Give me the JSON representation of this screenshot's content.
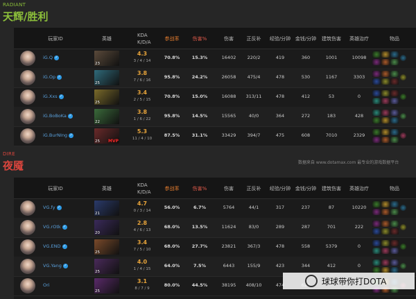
{
  "radiant": {
    "label": "RADIANT",
    "title": "天辉/胜利",
    "accent": "#8cbf3a",
    "columns": {
      "player_id": "玩家ID",
      "hero": "英雄",
      "kda_top": "KDA",
      "kda_bottom": "K/D/A",
      "participation": "参战率",
      "damage_pct": "伤害%",
      "damage": "伤害",
      "lh_dn": "正反补",
      "xpm": "经验/分钟",
      "gpm": "金钱/分钟",
      "building_dmg": "建筑伤害",
      "healing": "英雄治疗",
      "items": "物品"
    },
    "players": [
      {
        "name": "iG.Q",
        "hero_level": "23",
        "mvp": "",
        "kda_ratio": "4.3",
        "kda": "3 / 4 / 14",
        "participation": "70.8%",
        "damage_pct": "15.3%",
        "damage": "16402",
        "lh_dn": "220/2",
        "xpm": "419",
        "gpm": "360",
        "building_dmg": "1001",
        "healing": "10098",
        "hero_color": "#5a4a3a"
      },
      {
        "name": "iG.Op",
        "hero_level": "25",
        "mvp": "",
        "kda_ratio": "3.8",
        "kda": "7 / 6 / 16",
        "participation": "95.8%",
        "damage_pct": "24.2%",
        "damage": "26058",
        "lh_dn": "475/4",
        "xpm": "478",
        "gpm": "530",
        "building_dmg": "1167",
        "healing": "3303",
        "hero_color": "#2f6a7a"
      },
      {
        "name": "iG.Xxs",
        "hero_level": "25",
        "mvp": "",
        "kda_ratio": "3.4",
        "kda": "2 / 5 / 15",
        "participation": "70.8%",
        "damage_pct": "15.0%",
        "damage": "16088",
        "lh_dn": "313/11",
        "xpm": "478",
        "gpm": "412",
        "building_dmg": "53",
        "healing": "0",
        "hero_color": "#7a6a2a"
      },
      {
        "name": "iG.BoBoKa",
        "hero_level": "22",
        "mvp": "",
        "kda_ratio": "3.8",
        "kda": "1 / 6 / 22",
        "participation": "95.8%",
        "damage_pct": "14.5%",
        "damage": "15565",
        "lh_dn": "40/0",
        "xpm": "364",
        "gpm": "272",
        "building_dmg": "183",
        "healing": "428",
        "hero_color": "#3a6a3a"
      },
      {
        "name": "iG.BurNIng",
        "hero_level": "25",
        "mvp": "MVP",
        "kda_ratio": "5.3",
        "kda": "11 / 4 / 10",
        "participation": "87.5%",
        "damage_pct": "31.1%",
        "damage": "33429",
        "lh_dn": "394/7",
        "xpm": "475",
        "gpm": "608",
        "building_dmg": "7010",
        "healing": "2329",
        "hero_color": "#6a2a2a"
      }
    ]
  },
  "watermark": "数据来自 www.dotamax.com 最专业的游戏数据平台",
  "dire": {
    "label": "DIRE",
    "title": "夜魇",
    "accent": "#d9453d",
    "players": [
      {
        "name": "VG.fy",
        "hero_level": "21",
        "kda_ratio": "4.7",
        "kda": "0 / 3 / 14",
        "participation": "56.0%",
        "damage_pct": "6.7%",
        "damage": "5764",
        "lh_dn": "44/1",
        "xpm": "317",
        "gpm": "237",
        "building_dmg": "87",
        "healing": "10220",
        "hero_color": "#2a3a6a"
      },
      {
        "name": "VG.rOtk",
        "hero_level": "20",
        "kda_ratio": "2.8",
        "kda": "4 / 6 / 13",
        "participation": "68.0%",
        "damage_pct": "13.5%",
        "damage": "11624",
        "lh_dn": "83/0",
        "xpm": "289",
        "gpm": "287",
        "building_dmg": "701",
        "healing": "222",
        "hero_color": "#3a2a5a"
      },
      {
        "name": "VG.END",
        "hero_level": "25",
        "kda_ratio": "3.4",
        "kda": "7 / 5 / 10",
        "participation": "68.0%",
        "damage_pct": "27.7%",
        "damage": "23821",
        "lh_dn": "367/3",
        "xpm": "478",
        "gpm": "558",
        "building_dmg": "5379",
        "healing": "0",
        "hero_color": "#7a4a2a"
      },
      {
        "name": "VG.Yang",
        "hero_level": "25",
        "kda_ratio": "4.0",
        "kda": "1 / 4 / 15",
        "participation": "64.0%",
        "damage_pct": "7.5%",
        "damage": "6443",
        "lh_dn": "155/9",
        "xpm": "423",
        "gpm": "344",
        "building_dmg": "412",
        "healing": "0",
        "hero_color": "#4a2a5a"
      },
      {
        "name": "Ori",
        "hero_level": "25",
        "kda_ratio": "3.1",
        "kda": "8 / 7 / 9",
        "participation": "80.0%",
        "damage_pct": "44.5%",
        "damage": "38195",
        "lh_dn": "408/10",
        "xpm": "474",
        "gpm": "626",
        "building_dmg": "",
        "healing": "",
        "hero_color": "#5a2a6a"
      }
    ]
  },
  "brand_overlay": "球球带你打DOTA"
}
